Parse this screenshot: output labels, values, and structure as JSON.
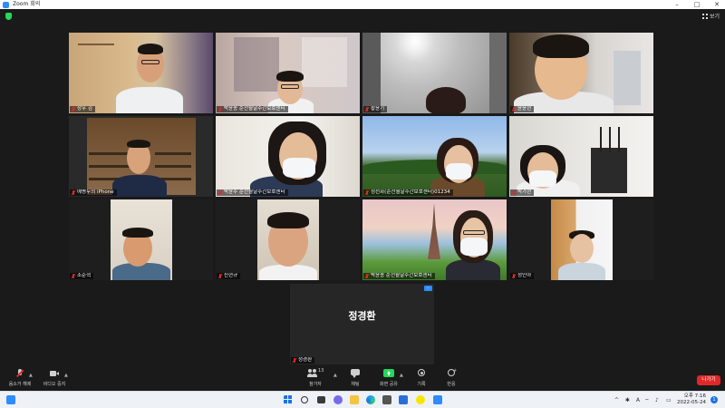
{
  "window": {
    "title": "Zoom 회의",
    "min": "–",
    "max": "□",
    "close": "✕"
  },
  "topbar": {
    "view_label": "보기"
  },
  "participants": [
    {
      "name": "상우 김",
      "muted": true
    },
    {
      "name": "박윤종 순천월달주간보호센터",
      "muted": true
    },
    {
      "name": "황윤기",
      "muted": true
    },
    {
      "name": "윤윤현",
      "muted": true
    },
    {
      "name": "예병두의 iPhone",
      "muted": true,
      "active": true
    },
    {
      "name": "박윤주 순천월달주간보호센터",
      "muted": true
    },
    {
      "name": "정선화(순천월달주간보호센터)01234",
      "muted": true
    },
    {
      "name": "박가현",
      "muted": true
    },
    {
      "name": "조준혁",
      "muted": true
    },
    {
      "name": "신현규",
      "muted": true
    },
    {
      "name": "박윤종 순천월달주간보호센터",
      "muted": true
    },
    {
      "name": "정인아",
      "muted": true
    },
    {
      "name": "정경환",
      "muted": true,
      "avatar_text": "정경환"
    }
  ],
  "toolbar": {
    "mute": "음소거 해제",
    "video": "비디오 중지",
    "participants": "참가자",
    "participants_count": "13",
    "chat": "채팅",
    "share": "화면 공유",
    "record": "기록",
    "reactions": "반응",
    "leave": "나가기"
  },
  "taskbar": {
    "time": "오후 7:16",
    "date": "2022-05-24",
    "lang": "A",
    "notif_count": "1"
  },
  "colors": {
    "zoom_blue": "#2d8cff",
    "share_green": "#23d959",
    "leave_red": "#e02828",
    "active_border": "#cfe86a"
  }
}
